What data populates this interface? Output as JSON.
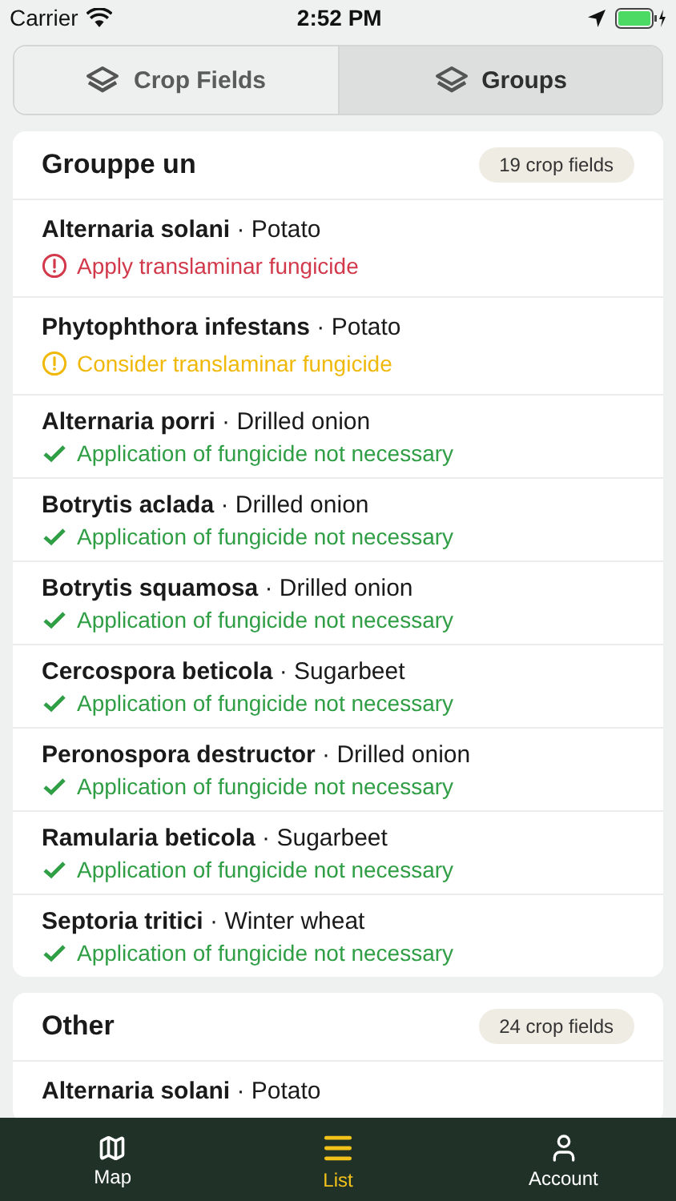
{
  "status_bar": {
    "carrier": "Carrier",
    "time": "2:52 PM"
  },
  "segments": [
    {
      "label": "Crop Fields",
      "selected": false
    },
    {
      "label": "Groups",
      "selected": true
    }
  ],
  "groups": [
    {
      "name": "Grouppe un",
      "count": "19 crop fields",
      "rows": [
        {
          "title": "**Alternaria solani** · Potato",
          "status": "Apply translaminar fungicide",
          "kind": "alert"
        },
        {
          "title": "**Phytophthora infestans** · Potato",
          "status": "Consider translaminar fungicide",
          "kind": "warning"
        },
        {
          "title": "**Alternaria porri** · Drilled onion",
          "status": "Application of fungicide not necessary",
          "kind": "ok"
        },
        {
          "title": "**Botrytis aclada** · Drilled onion",
          "status": "Application of fungicide not necessary",
          "kind": "ok"
        },
        {
          "title": "**Botrytis squamosa** · Drilled onion",
          "status": "Application of fungicide not necessary",
          "kind": "ok"
        },
        {
          "title": "**Cercospora beticola** · Sugarbeet",
          "status": "Application of fungicide not necessary",
          "kind": "ok"
        },
        {
          "title": "**Peronospora destructor** · Drilled onion",
          "status": "Application of fungicide not necessary",
          "kind": "ok"
        },
        {
          "title": "**Ramularia beticola** · Sugarbeet",
          "status": "Application of fungicide not necessary",
          "kind": "ok"
        },
        {
          "title": "**Septoria tritici** · Winter wheat",
          "status": "Application of fungicide not necessary",
          "kind": "ok"
        }
      ]
    },
    {
      "name": "Other",
      "count": "24 crop fields",
      "rows": [
        {
          "title": "**Alternaria solani** · Potato"
        }
      ]
    }
  ],
  "tab_bar": [
    {
      "label": "Map",
      "selected": false
    },
    {
      "label": "List",
      "selected": true
    },
    {
      "label": "Account",
      "selected": false
    }
  ]
}
